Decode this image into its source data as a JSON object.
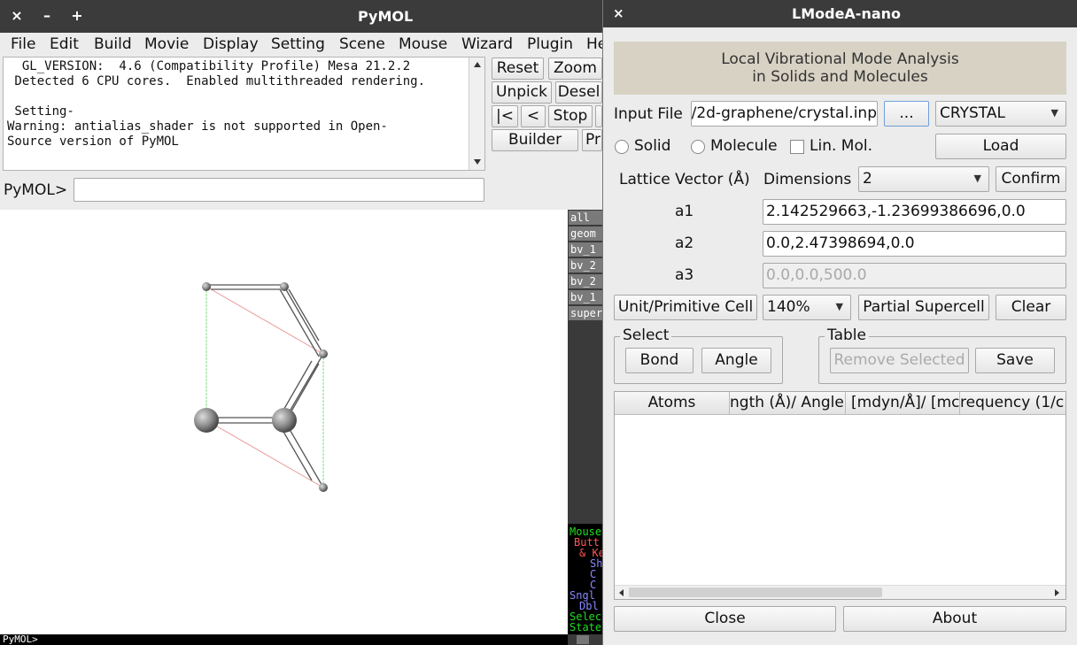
{
  "pymol": {
    "title": "PyMOL",
    "window_buttons": {
      "close": "×",
      "minimize": "–",
      "maximize": "+"
    },
    "menu": [
      "File",
      "Edit",
      "Build",
      "Movie",
      "Display",
      "Setting",
      "Scene",
      "Mouse",
      "Wizard",
      "Plugin",
      "He"
    ],
    "log_lines": [
      "  GL_VERSION:  4.6 (Compatibility Profile) Mesa 21.2.2",
      " Detected 6 CPU cores.  Enabled multithreaded rendering.",
      "",
      " Setting-",
      "Warning: antialias_shader is not supported in Open-",
      "Source version of PyMOL"
    ],
    "buttons": {
      "reset": "Reset",
      "zoom": "Zoom",
      "unpick": "Unpick",
      "deselect": "Desel",
      "rewind": "|<",
      "back": "<",
      "stop": "Stop",
      "builder": "Builder",
      "properties": "Pr"
    },
    "prompt_label": "PyMOL>",
    "command_value": "",
    "objects": [
      "all",
      "geom",
      "bv_1",
      "bv_2",
      "bv_2",
      "bv_1",
      "super"
    ],
    "mouse_panel": [
      {
        "text": "Mouse",
        "color": "#22dd22"
      },
      {
        "text": "Butt",
        "color": "#ff5555"
      },
      {
        "text": "& Ke",
        "color": "#ff5555"
      },
      {
        "text": "Sh",
        "color": "#8888ff"
      },
      {
        "text": "C",
        "color": "#8888ff"
      },
      {
        "text": "C",
        "color": "#8888ff"
      },
      {
        "text": "Sngl",
        "color": "#8888ff"
      },
      {
        "text": "Dbl",
        "color": "#8888ff"
      },
      {
        "text": "Selec",
        "color": "#22dd22"
      },
      {
        "text": "State",
        "color": "#22dd22"
      }
    ],
    "status_line": "PyMOL>"
  },
  "lmodea": {
    "title": "LModeA-nano",
    "close_glyph": "×",
    "banner_line1": "Local Vibrational Mode Analysis",
    "banner_line2": "in Solids and Molecules",
    "input_file_label": "Input File",
    "input_file_value": "/2d-graphene/crystal.inp",
    "browse_label": "...",
    "program_selected": "CRYSTAL",
    "solid_label": "Solid",
    "molecule_label": "Molecule",
    "linear_label": "Lin. Mol.",
    "load_label": "Load",
    "lattice_label": "Lattice Vector (Å)",
    "dimensions_label": "Dimensions",
    "dimensions_selected": "2",
    "confirm_label": "Confirm",
    "vectors": [
      {
        "label": "a1",
        "value": "2.142529663,-1.23699386696,0.0"
      },
      {
        "label": "a2",
        "value": "0.0,2.47398694,0.0"
      },
      {
        "label": "a3",
        "value": "0.0,0.0,500.0"
      }
    ],
    "cell_button": "Unit/Primitive Cell",
    "scale_selected": "140%",
    "supercell_button": "Partial Supercell",
    "clear_button": "Clear",
    "select_group": "Select",
    "bond_button": "Bond",
    "angle_button": "Angle",
    "table_group": "Table",
    "remove_button": "Remove Selected",
    "save_button": "Save",
    "columns": [
      "Atoms",
      "ngth (Å)/ Angle",
      "[mdyn/Å]/ [mc",
      "requency (1/c"
    ],
    "close_button": "Close",
    "about_button": "About"
  }
}
